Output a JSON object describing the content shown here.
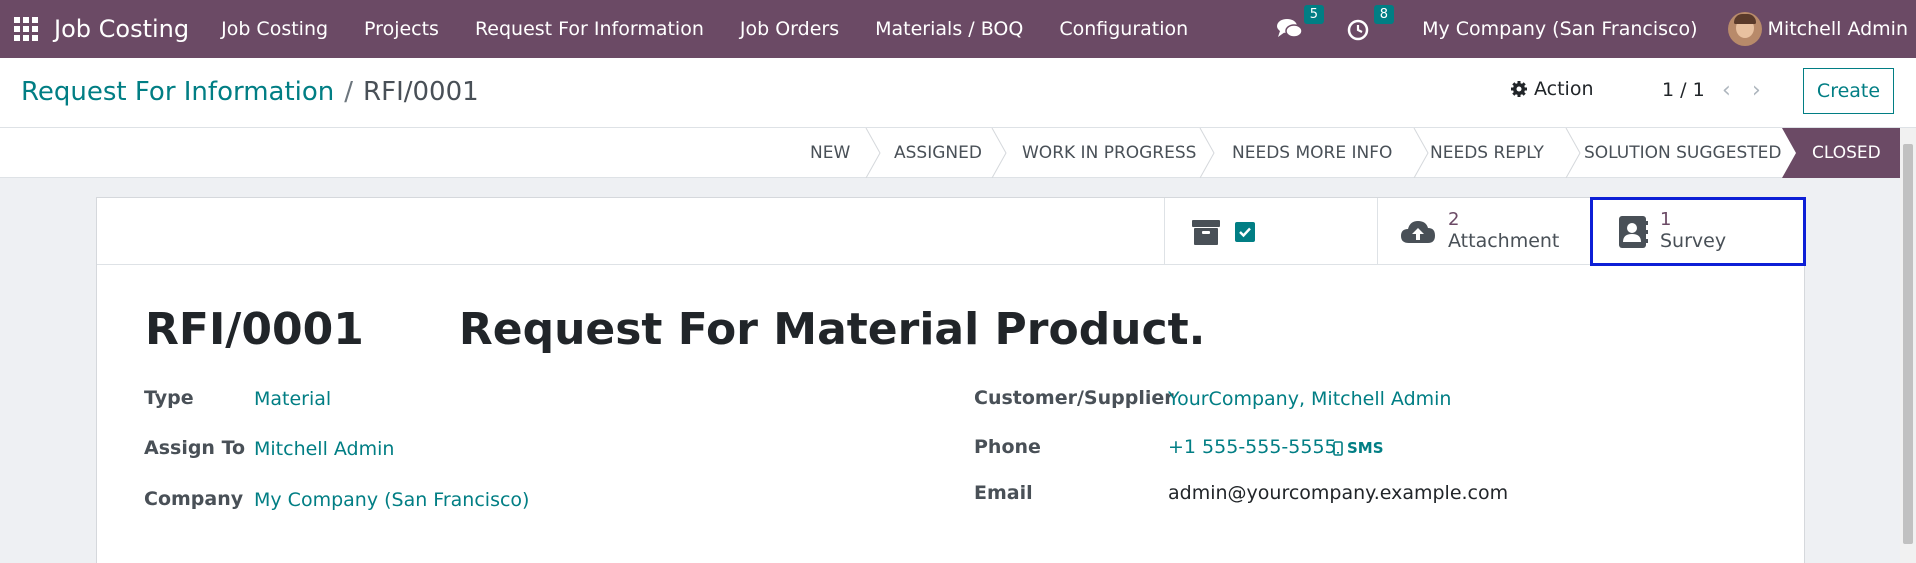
{
  "navbar": {
    "brand": "Job Costing",
    "menu": [
      "Job Costing",
      "Projects",
      "Request For Information",
      "Job Orders",
      "Materials / BOQ",
      "Configuration"
    ],
    "messages_count": "5",
    "activities_count": "8",
    "company": "My Company (San Francisco)",
    "user": "Mitchell Admin"
  },
  "control_panel": {
    "breadcrumb_parent": "Request For Information",
    "breadcrumb_separator": "/",
    "breadcrumb_current": "RFI/0001",
    "action_label": "Action",
    "pager": "1 / 1",
    "create_label": "Create"
  },
  "statusbar": {
    "stages": [
      "NEW",
      "ASSIGNED",
      "WORK IN PROGRESS",
      "NEEDS MORE INFO",
      "NEEDS REPLY",
      "SOLUTION SUGGESTED",
      "CLOSED"
    ],
    "active_stage": "CLOSED"
  },
  "smart_buttons": {
    "attachment_count": "2",
    "attachment_label": "Attachment",
    "survey_count": "1",
    "survey_label": "Survey"
  },
  "record": {
    "reference": "RFI/0001",
    "subject": "Request For Material Product.",
    "left_fields": [
      {
        "label": "Type",
        "value": "Material"
      },
      {
        "label": "Assign To",
        "value": "Mitchell Admin"
      },
      {
        "label": "Company",
        "value": "My Company (San Francisco)"
      }
    ],
    "right_fields": [
      {
        "label": "Customer/Supplier",
        "value": "YourCompany, Mitchell Admin"
      },
      {
        "label": "Phone",
        "value": "+1 555-555-5555"
      },
      {
        "label": "Email",
        "value": "admin@yourcompany.example.com"
      }
    ],
    "sms_label": "SMS"
  },
  "colors": {
    "navbar": "#6b4a65",
    "accent": "#017e84",
    "highlight": "#0d1fd6"
  }
}
